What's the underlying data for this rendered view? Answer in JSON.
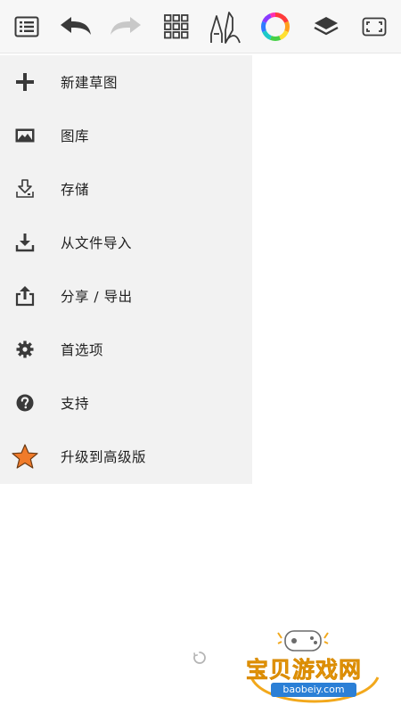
{
  "toolbar": {
    "icons": [
      "list-menu-icon",
      "undo-icon",
      "redo-icon",
      "grid-icon",
      "brush-tools-icon",
      "color-wheel-icon",
      "layers-icon",
      "fullscreen-icon"
    ]
  },
  "menu": {
    "items": [
      {
        "label": "新建草图",
        "icon": "plus-icon"
      },
      {
        "label": "图库",
        "icon": "gallery-icon"
      },
      {
        "label": "存储",
        "icon": "save-icon"
      },
      {
        "label": "从文件导入",
        "icon": "import-icon"
      },
      {
        "label": "分享 / 导出",
        "icon": "share-icon"
      },
      {
        "label": "首选项",
        "icon": "gear-icon"
      },
      {
        "label": "支持",
        "icon": "help-icon"
      },
      {
        "label": "升级到高级版",
        "icon": "star-icon"
      }
    ]
  },
  "colors": {
    "accent_star": "#f07b2a",
    "icon_dark": "#3a3a3a",
    "icon_disabled": "#c8c8c8",
    "menu_bg": "#f2f2f2"
  },
  "watermark": {
    "title": "宝贝游戏网",
    "url": "baobeiy.com"
  }
}
